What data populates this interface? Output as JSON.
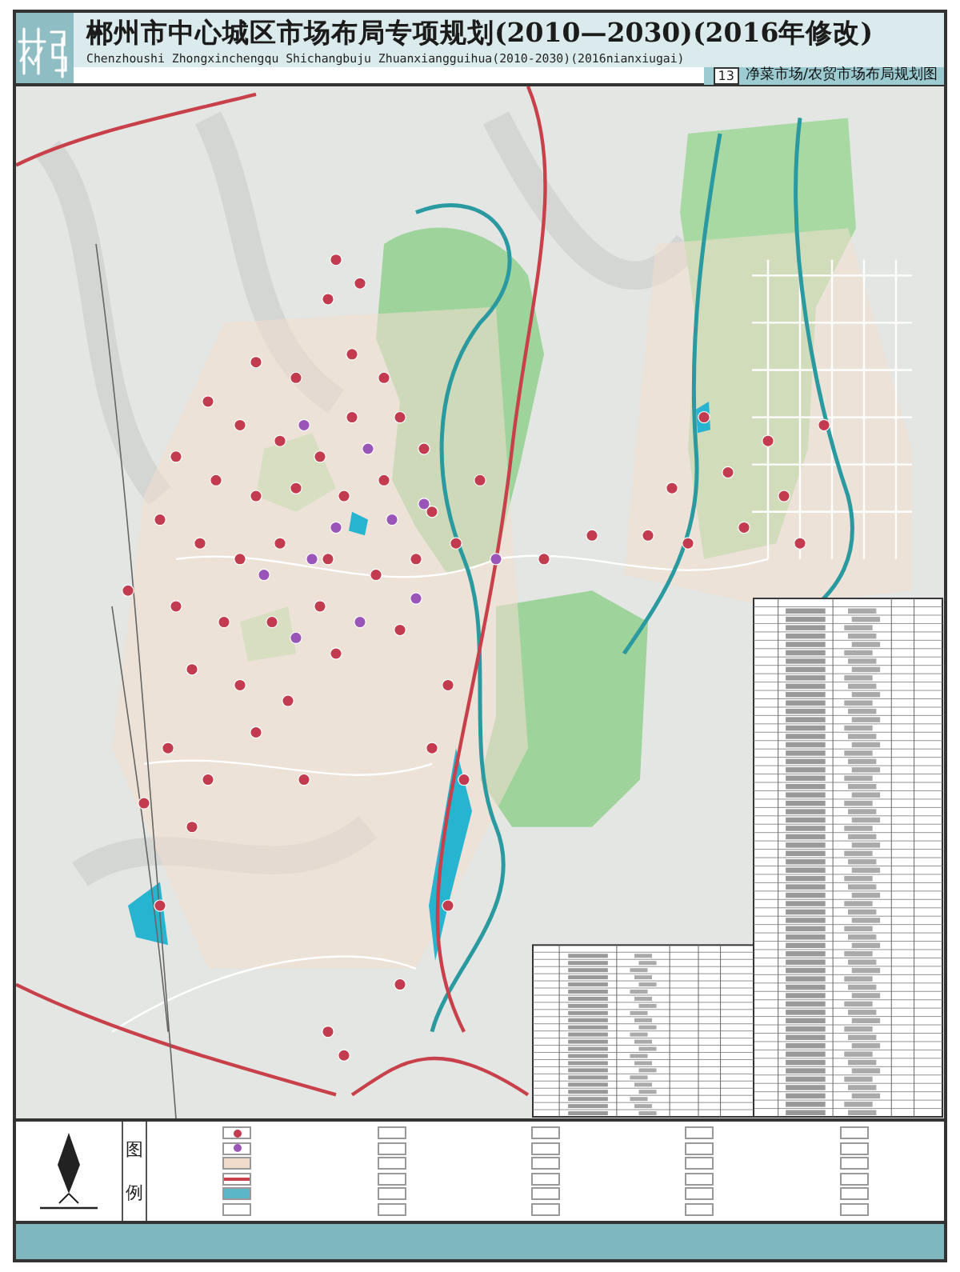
{
  "header": {
    "title": "郴州市中心城区市场布局专项规划(2010—2030)(2016年修改)",
    "subtitle": "Chenzhoushi Zhongxinchengqu Shichangbuju Zhuanxiangguihua(2010-2030)(2016nianxiugai)",
    "sheet_number": "13",
    "sheet_title": "净菜市场/农贸市场布局规划图"
  },
  "legend": {
    "heading": [
      "图",
      "例"
    ],
    "items": [
      {
        "kind": "dot",
        "color": "#c23b4e"
      },
      {
        "kind": "dot",
        "color": "#9a55b8"
      },
      {
        "kind": "area",
        "color": "#f1dccb"
      },
      {
        "kind": "line",
        "color": "#c8404a"
      },
      {
        "kind": "water",
        "color": "#5bb6c8"
      },
      {
        "kind": "blank",
        "color": "#ffffff"
      }
    ]
  }
}
